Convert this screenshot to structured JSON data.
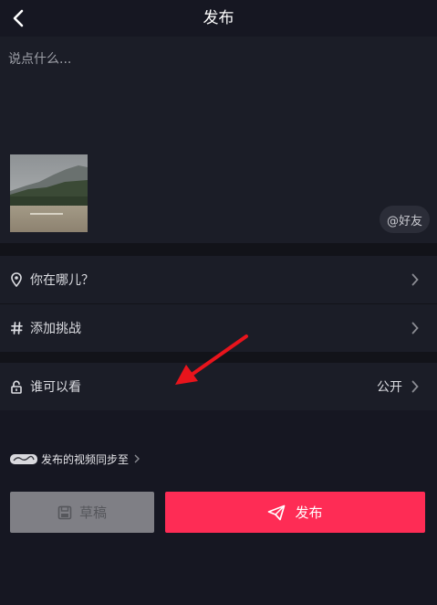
{
  "header": {
    "title": "发布",
    "back_icon": "chevron-left-icon"
  },
  "compose": {
    "placeholder": "说点什么...",
    "mention_label": "@好友"
  },
  "options": [
    {
      "icon": "location-pin-icon",
      "label": "你在哪儿？",
      "value": ""
    },
    {
      "icon": "hashtag-icon",
      "label": "添加挑战",
      "value": ""
    },
    {
      "icon": "unlock-icon",
      "label": "谁可以看",
      "value": "公开"
    }
  ],
  "sync": {
    "label": "发布的视频同步至"
  },
  "actions": {
    "draft_label": "草稿",
    "publish_label": "发布"
  },
  "colors": {
    "accent": "#fe2c55",
    "background": "#161722",
    "panel": "#1b1d27",
    "annotation_arrow": "#e8141c"
  }
}
